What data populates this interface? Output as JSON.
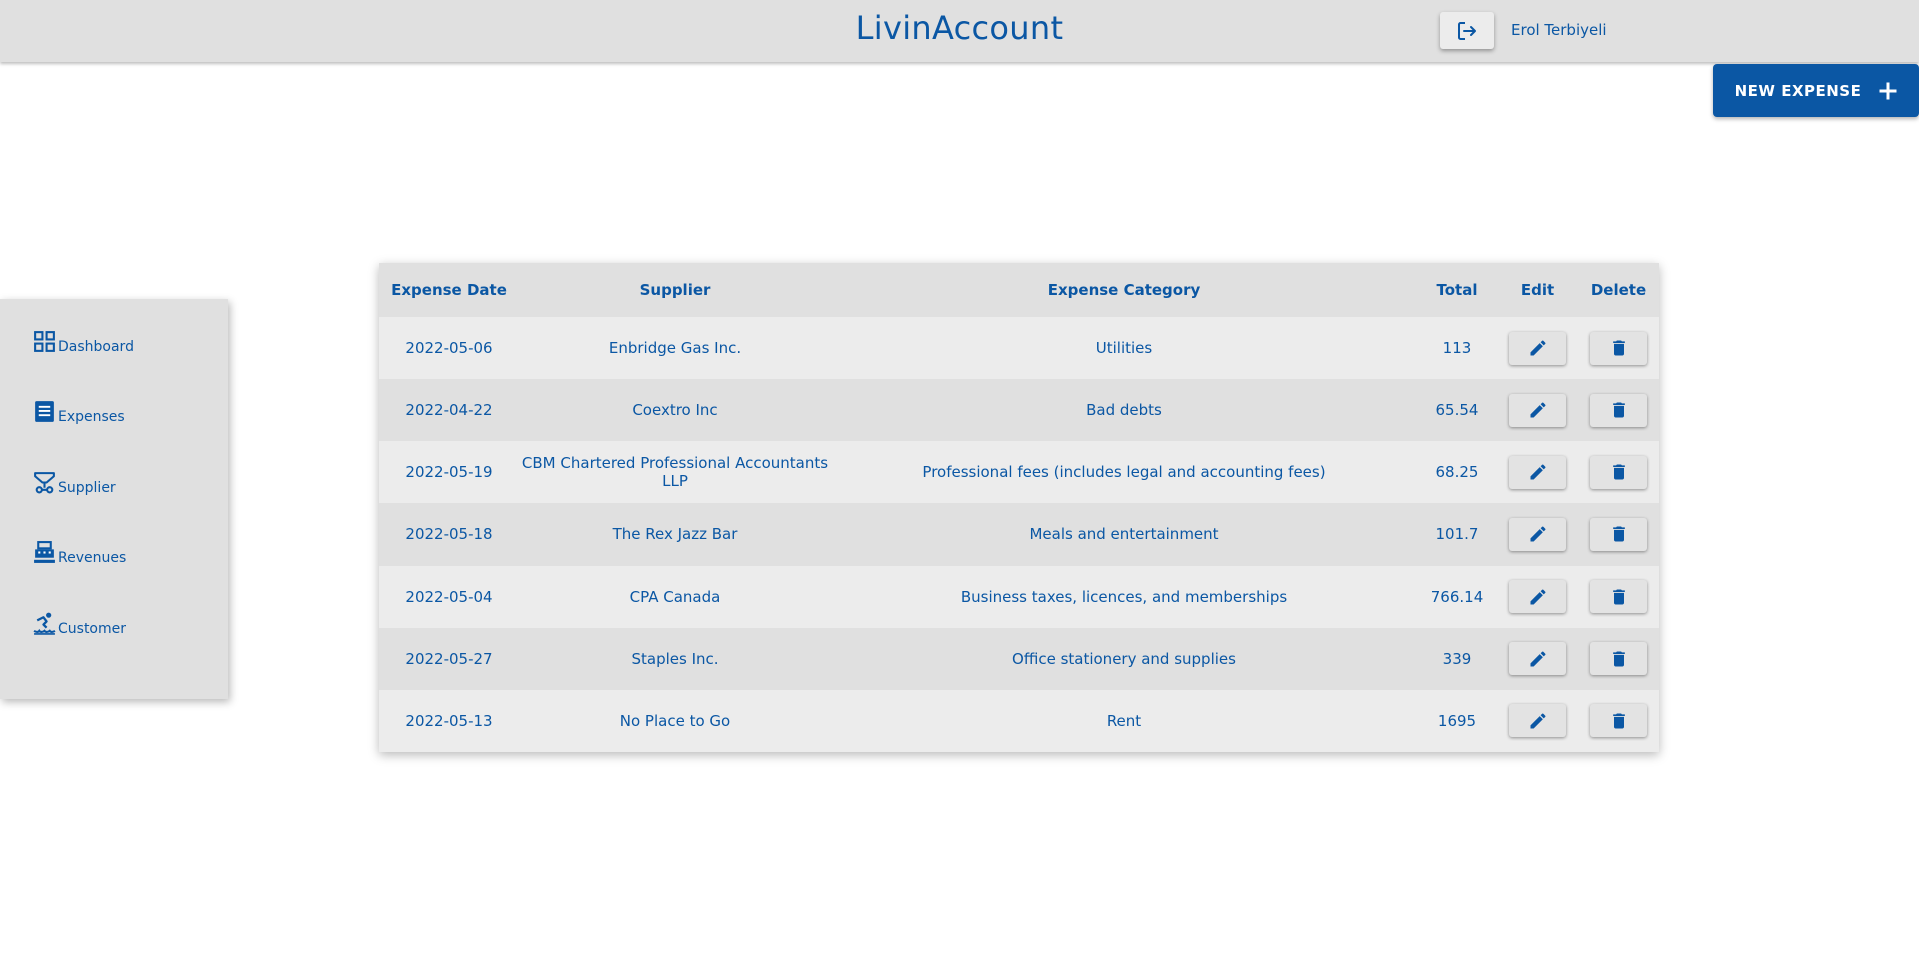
{
  "header": {
    "title": "LivinAccount",
    "user_name": "Erol Terbiyeli",
    "logout_icon": "logout-icon"
  },
  "actions": {
    "new_expense_label": "NEW EXPENSE",
    "new_expense_icon": "plus-icon"
  },
  "sidebar": {
    "items": [
      {
        "label": "Dashboard",
        "icon": "dashboard-icon"
      },
      {
        "label": "Expenses",
        "icon": "expenses-icon"
      },
      {
        "label": "Supplier",
        "icon": "supplier-icon"
      },
      {
        "label": "Revenues",
        "icon": "revenues-icon"
      },
      {
        "label": "Customer",
        "icon": "customer-icon"
      }
    ]
  },
  "table": {
    "columns": [
      "Expense Date",
      "Supplier",
      "Expense Category",
      "Total",
      "Edit",
      "Delete"
    ],
    "rows": [
      {
        "date": "2022-05-06",
        "supplier": "Enbridge Gas Inc.",
        "category": "Utilities",
        "total": "113"
      },
      {
        "date": "2022-04-22",
        "supplier": "Coextro Inc",
        "category": "Bad debts",
        "total": "65.54"
      },
      {
        "date": "2022-05-19",
        "supplier": "CBM Chartered Professional Accountants LLP",
        "category": "Professional fees (includes legal and accounting fees)",
        "total": "68.25"
      },
      {
        "date": "2022-05-18",
        "supplier": "The Rex Jazz Bar",
        "category": "Meals and entertainment",
        "total": "101.7"
      },
      {
        "date": "2022-05-04",
        "supplier": "CPA Canada",
        "category": "Business taxes, licences, and memberships",
        "total": "766.14"
      },
      {
        "date": "2022-05-27",
        "supplier": "Staples Inc.",
        "category": "Office stationery and supplies",
        "total": "339"
      },
      {
        "date": "2022-05-13",
        "supplier": "No Place to Go",
        "category": "Rent",
        "total": "1695"
      }
    ],
    "edit_icon": "pencil-icon",
    "delete_icon": "trash-icon"
  },
  "colors": {
    "accent": "#0b57a4",
    "header_bg": "#e0e0e0",
    "row_light": "#ececec",
    "row_dark": "#e0e0e0"
  }
}
